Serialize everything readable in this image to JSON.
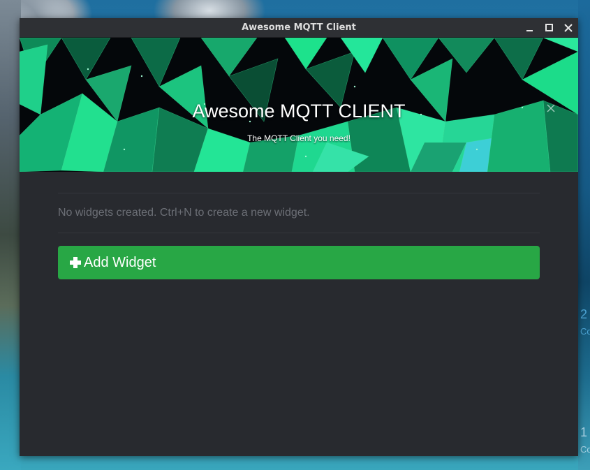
{
  "window": {
    "title": "Awesome MQTT Client"
  },
  "banner": {
    "title": "Awesome MQTT CLIENT",
    "subtitle": "The MQTT Client you need!"
  },
  "main": {
    "empty_message": "No widgets created. Ctrl+N to create a new widget.",
    "add_button_label": "Add Widget"
  },
  "desktop": {
    "widget_text_1": "2",
    "widget_text_2": "Co",
    "widget_text_3": "1",
    "widget_text_4": "Co"
  },
  "colors": {
    "accent_green": "#28a745",
    "window_bg": "#282a2f",
    "titlebar_bg": "#2e3034",
    "banner_polygon": "#1de28c"
  },
  "icons": {
    "minimize": "minimize-icon",
    "maximize": "maximize-icon",
    "close": "close-icon",
    "banner_close": "close-icon",
    "add": "plus-icon"
  }
}
